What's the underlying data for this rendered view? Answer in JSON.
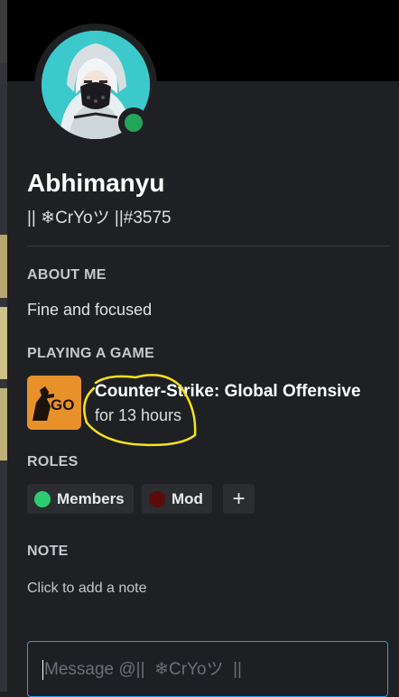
{
  "profile": {
    "display_name": "Abhimanyu",
    "tag": "|| ❄CrYoツ ||#3575",
    "status": "online",
    "status_color": "#23a55a"
  },
  "sections": {
    "about_title": "ABOUT ME",
    "about_text": "Fine and focused",
    "playing_title": "PLAYING A GAME",
    "roles_title": "ROLES",
    "note_title": "NOTE",
    "note_hint": "Click to add a note"
  },
  "game": {
    "icon_text": "GO",
    "name": "Counter-Strike: Global Offensive",
    "time": "for 13 hours"
  },
  "roles": [
    {
      "label": "Members",
      "color": "#2ecc71"
    },
    {
      "label": "Mod",
      "color": "#5c0a0a"
    }
  ],
  "role_add_label": "+",
  "message": {
    "placeholder": "Message @||  ❄CrYoツ  ||"
  },
  "colors": {
    "accent_border": "#1da1f2",
    "highlight_annotation": "#f7e21b"
  }
}
